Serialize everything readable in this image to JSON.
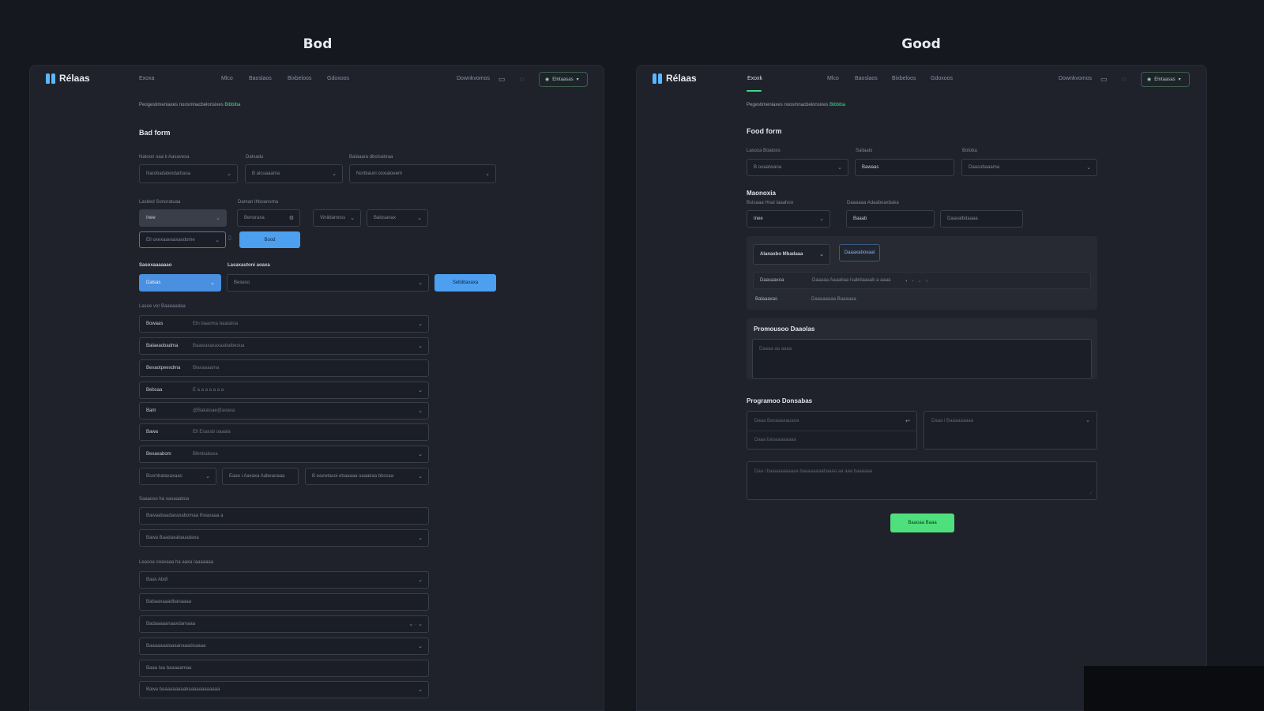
{
  "headings": {
    "bad": "Bod",
    "good": "Good"
  },
  "brand": {
    "name": "Rélaas",
    "logo_color": "#5bb8ff"
  },
  "colors": {
    "accent_green": "#3ddc84",
    "accent_blue": "#4d9ff0",
    "background": "#16181f",
    "panel": "#1f222b"
  },
  "bad_panel": {
    "nav": {
      "links": [
        "Exoxa",
        "Mlco",
        "Baoslaos",
        "Bixbeloos",
        "Gdoxoos"
      ],
      "search_text": "Downkvomos",
      "icons": [
        "card-icon",
        "user-icon"
      ],
      "account_label": "Elntaasas"
    },
    "breadcrumb": {
      "text": "Peogestimeniaxes noosmnacbelonsixes",
      "link": "Bibbiba"
    },
    "form_title": "Bad form",
    "row1": [
      {
        "label": "Natoon oaa k Aaxavesa",
        "value": "Narobadatexdarbasa"
      },
      {
        "label": "Datsadu",
        "value": "B alcuaaama"
      },
      {
        "label": "Balaaara dbolsabraa",
        "value": "Norbiauni ooxialoeem"
      }
    ],
    "row2": {
      "label_left": "Lasbed Sonoratuaa",
      "label_right": "Daman Ihboanoma",
      "select_value": "Inee",
      "input_value": "Benoraxa",
      "small_select_1": "Vinildamoss",
      "small_select_2": "Balosanax",
      "blue_select": "Ell oxexaavaaxaxdome",
      "button": "Bood"
    },
    "row3": {
      "label_left": "Sasoxaaaaaao",
      "label_right": "Lasaxautoni aoaxa",
      "select_value": "Dalsas",
      "input_value": "Beseso",
      "button": "Sebilitaxaxa"
    },
    "group_label": "Lasoe vor Baaeaadaa",
    "rows": [
      {
        "label": "Bowaas",
        "value": "Eln baaoma baatatoa"
      },
      {
        "label": "Balaeaobadma",
        "value": "Baawaxaxaxaabalbeoua"
      },
      {
        "label": "Bexaotpeexdma",
        "value": "Blaxaaaama"
      },
      {
        "label": "Bebsaa",
        "value": "E a a a   a a a a"
      },
      {
        "label": "Bam",
        "value": "@Bakaisae@aoava"
      },
      {
        "label": "Bawa",
        "value": "Ell Esassb oaaaia"
      },
      {
        "label": "Bexaxabom",
        "value": "Blbnbabasa"
      }
    ],
    "triple": [
      "Bsxmbataxaxaas",
      "Eaao i Aaxaxa Aabeaoaaa",
      "B eaxwtaxoi ebaaaaa oaaakaa bbssaa"
    ],
    "group2_label": "Saaaoso ha oaxaaabca",
    "group2_rows": [
      "Bawaabaadaxaxabomaa Ihoaxaaa a",
      "Bawa Baadaxabauadaxa"
    ],
    "group3_label": "Leasoa ooaxaaa ha aaxa Iaaaaaaa",
    "group3_rows": [
      "Baas Abdl",
      "Babaaxaaadbanaaaa",
      "Badaaaaanaaxdamaaa",
      "Baaaaaaalaaaanaaadoaaaa",
      "Baaa Iaa baaaaamaa",
      "Bawa baaaaaaaaabaaaaaaaaaaaa"
    ]
  },
  "good_panel": {
    "nav": {
      "links": [
        "Exoxk",
        "Mlco",
        "Baoslaos",
        "Bixbeloos",
        "Gdoxoos"
      ],
      "search_text": "Downkvomos",
      "icons": [
        "card-icon",
        "user-icon"
      ],
      "account_label": "Elntaasas"
    },
    "breadcrumb": {
      "text": "Pegestimeniaxes noosmnacbelonsixes",
      "link": "Bibbiba"
    },
    "form_title": "Food form",
    "row1": [
      {
        "label": "Lasoca Boatoxs",
        "value": "B ooaatwana"
      },
      {
        "label": "Sailaalo",
        "value": "Bawaas"
      },
      {
        "label": "Boloba",
        "value": "Daasobaaama"
      }
    ],
    "subsection_title": "Maonoxia",
    "subsection_labels": [
      "Bstsaaa Hnal Iaaahoo",
      "Daaaaaa Adaaboaxbaka"
    ],
    "row2": {
      "select_value": "Inee",
      "input_1": "Baaab",
      "input_2": "Daaxalbdaaaa"
    },
    "card": {
      "select_value": "Alanaxbo Mbadaaa",
      "button": "Daaaxaboxaal",
      "row1_label": "Daasaaxoa",
      "row1_value": "Daaaaa Aaaabaa Isabdaaaab a aaaa",
      "row2_label": "Balaaaxas",
      "row2_value": "Daaaaaaaa Baaaaaa"
    },
    "promo": {
      "title": "Promousoo Daaolas",
      "placeholder": "Daaaa aa aaaa"
    },
    "prog_title": "Programoo Donsabas",
    "prog_left_top": "Daaa Baoaaaxauaoa",
    "prog_left_bottom": "Daaa baoaaaaaaaa",
    "prog_right": "Daaa i Baaaaaaaaa",
    "prog_textarea": "Daa i baaaaaaaaaaa baaaaaaaabaaaa aa aaa baaaaaa",
    "submit": "Baaoaa Baaa"
  }
}
